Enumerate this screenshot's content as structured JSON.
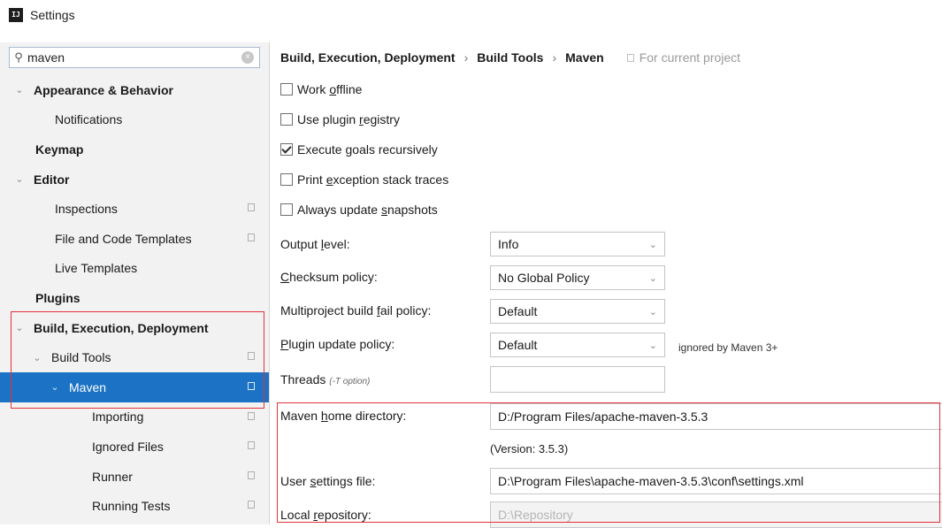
{
  "window": {
    "title": "Settings",
    "icon": "intellij-icon"
  },
  "search": {
    "value": "maven",
    "placeholder": ""
  },
  "sidebar": {
    "items": [
      {
        "label": "Appearance & Behavior",
        "arrow": "⌄"
      },
      {
        "label": "Notifications"
      },
      {
        "label": "Keymap"
      },
      {
        "label": "Editor",
        "arrow": "⌄"
      },
      {
        "label": "Inspections"
      },
      {
        "label": "File and Code Templates"
      },
      {
        "label": "Live Templates"
      },
      {
        "label": "Plugins"
      },
      {
        "label": "Build, Execution, Deployment",
        "arrow": "⌄"
      },
      {
        "label": "Build Tools",
        "arrow": "⌄"
      },
      {
        "label": "Maven",
        "arrow": "⌄"
      },
      {
        "label": "Importing"
      },
      {
        "label": "Ignored Files"
      },
      {
        "label": "Runner"
      },
      {
        "label": "Running Tests"
      }
    ]
  },
  "breadcrumb": {
    "part1": "Build, Execution, Deployment",
    "sep": "›",
    "part2": "Build Tools",
    "part3": "Maven",
    "scope": "For current project"
  },
  "options": {
    "work_offline": {
      "pre": "Work ",
      "u": "o",
      "post": "ffline",
      "checked": false
    },
    "plugin_registry": {
      "pre": "Use plugin ",
      "u": "r",
      "post": "egistry",
      "checked": false
    },
    "recursive": {
      "pre": "Execute ",
      "u": "g",
      "post": "oals recursively",
      "checked": true
    },
    "stack_traces": {
      "pre": "Print ",
      "u": "e",
      "post": "xception stack traces",
      "checked": false
    },
    "snapshots": {
      "pre": "Always update ",
      "u": "s",
      "post": "napshots",
      "checked": false
    }
  },
  "form": {
    "output_level": {
      "pre": "Output ",
      "u": "l",
      "post": "evel:",
      "value": "Info"
    },
    "checksum": {
      "pre": "",
      "u": "C",
      "post": "hecksum policy:",
      "value": "No Global Policy"
    },
    "multiproject": {
      "pre": "Multiproject build ",
      "u": "f",
      "post": "ail policy:",
      "value": "Default"
    },
    "plugin_update": {
      "pre": "",
      "u": "P",
      "post": "lugin update policy:",
      "value": "Default",
      "hint": "ignored by Maven 3+"
    },
    "threads": {
      "label": "Threads",
      "hint": "(-T option)",
      "value": ""
    },
    "home_dir": {
      "pre": "Maven ",
      "u": "h",
      "post": "ome directory:",
      "value": "D:/Program Files/apache-maven-3.5.3",
      "version": "(Version: 3.5.3)"
    },
    "user_settings": {
      "pre": "User ",
      "u": "s",
      "post": "ettings file:",
      "value": "D:\\Program Files\\apache-maven-3.5.3\\conf\\settings.xml"
    },
    "local_repo": {
      "pre": "Local ",
      "u": "r",
      "post": "epository:",
      "value": "D:\\Repository"
    }
  },
  "colors": {
    "selection": "#1c72c4",
    "highlight_border": "#e2323a",
    "sidebar_bg": "#f2f2f2"
  }
}
